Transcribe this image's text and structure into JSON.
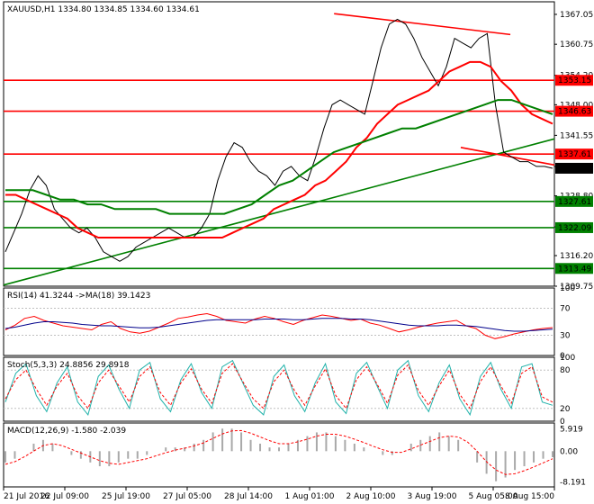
{
  "chart_data": [
    {
      "type": "line",
      "panel": "price",
      "title": "XAUUSD,H1 1334.80 1334.85 1334.60 1334.61",
      "symbol": "XAUUSD,H1",
      "ohlc": [
        1334.8,
        1334.85,
        1334.6,
        1334.61
      ],
      "ylim": [
        1309.75,
        1369.7
      ],
      "yticks": [
        "1367.05",
        "1360.75",
        "1354.20",
        "1348.00",
        "1341.55",
        "1335.00",
        "1328.80",
        "1322.25",
        "1316.20",
        "1309.75"
      ],
      "levels": [
        {
          "value": 1353.15,
          "label": "1353.15",
          "color": "#ff0000"
        },
        {
          "value": 1346.63,
          "label": "1346.63",
          "color": "#ff0000"
        },
        {
          "value": 1337.61,
          "label": "1337.61",
          "color": "#ff0000"
        },
        {
          "value": 1327.61,
          "label": "1327.61",
          "color": "#008000"
        },
        {
          "value": 1322.09,
          "label": "1322.09",
          "color": "#008000"
        },
        {
          "value": 1313.49,
          "label": "1313.49",
          "color": "#008000"
        }
      ],
      "current_price": {
        "value": 1334.61,
        "label": "1334.61"
      },
      "trendlines": [
        {
          "color": "#008000",
          "points": [
            [
              0.0,
              1310.0
            ],
            [
              1.0,
              1340.8
            ]
          ]
        },
        {
          "color": "#ff0000",
          "points": [
            [
              0.6,
              1367.2
            ],
            [
              0.92,
              1362.8
            ]
          ]
        },
        {
          "color": "#ff0000",
          "points": [
            [
              0.83,
              1339.0
            ],
            [
              1.0,
              1335.3
            ]
          ]
        }
      ],
      "series": [
        {
          "name": "Close",
          "color": "#000000",
          "values": [
            1317,
            1321,
            1325,
            1330,
            1333,
            1331,
            1326,
            1324,
            1322,
            1321,
            1322,
            1320,
            1317,
            1316,
            1315,
            1316,
            1318,
            1319,
            1320,
            1321,
            1322,
            1321,
            1320,
            1320,
            1322,
            1325,
            1332,
            1337,
            1340,
            1339,
            1336,
            1334,
            1333,
            1331,
            1334,
            1335,
            1333,
            1332,
            1337,
            1343,
            1348,
            1349,
            1348,
            1347,
            1346,
            1353,
            1360,
            1365,
            1366,
            1365,
            1362,
            1358,
            1355,
            1352,
            1356,
            1362,
            1361,
            1360,
            1362,
            1363,
            1348,
            1338,
            1337,
            1336,
            1336,
            1335,
            1335,
            1334.61
          ]
        },
        {
          "name": "MA fast",
          "color": "#ff0000",
          "values": [
            1329,
            1329,
            1328,
            1327,
            1326,
            1325,
            1324,
            1322,
            1321,
            1320,
            1320,
            1320,
            1320,
            1320,
            1320,
            1320,
            1320,
            1320,
            1320,
            1320,
            1320,
            1320,
            1321,
            1322,
            1323,
            1324,
            1326,
            1327,
            1328,
            1329,
            1331,
            1332,
            1334,
            1336,
            1339,
            1341,
            1344,
            1346,
            1348,
            1349,
            1350,
            1351,
            1353,
            1355,
            1356,
            1357,
            1357,
            1356,
            1353,
            1351,
            1348,
            1346,
            1345,
            1344
          ]
        },
        {
          "name": "MA slow",
          "color": "#008000",
          "values": [
            1330,
            1330,
            1330,
            1329,
            1328,
            1328,
            1327,
            1327,
            1326,
            1326,
            1326,
            1326,
            1325,
            1325,
            1325,
            1325,
            1325,
            1326,
            1327,
            1329,
            1331,
            1332,
            1334,
            1336,
            1338,
            1339,
            1340,
            1341,
            1342,
            1343,
            1343,
            1344,
            1345,
            1346,
            1347,
            1348,
            1349,
            1349,
            1348,
            1347,
            1346
          ]
        }
      ]
    },
    {
      "type": "line",
      "panel": "rsi",
      "title": "RSI(14) 41.3244 ->MA(18) 39.1423",
      "ylim": [
        0,
        100
      ],
      "yticks": [
        "100",
        "70",
        "30",
        "0"
      ],
      "series": [
        {
          "name": "RSI(14)",
          "color": "#ff0000",
          "values": [
            38,
            45,
            55,
            58,
            52,
            48,
            44,
            42,
            40,
            38,
            46,
            50,
            40,
            35,
            33,
            36,
            42,
            48,
            55,
            57,
            60,
            62,
            58,
            52,
            50,
            48,
            54,
            58,
            55,
            50,
            46,
            52,
            56,
            60,
            58,
            55,
            52,
            54,
            48,
            45,
            40,
            35,
            38,
            42,
            45,
            48,
            50,
            52,
            44,
            40,
            30,
            25,
            28,
            32,
            35,
            38,
            40,
            41.3
          ]
        },
        {
          "name": "MA(18)",
          "color": "#00008b",
          "values": [
            40,
            42,
            45,
            48,
            50,
            50,
            49,
            48,
            46,
            45,
            44,
            44,
            43,
            42,
            41,
            41,
            42,
            44,
            46,
            48,
            50,
            52,
            53,
            53,
            53,
            53,
            53,
            54,
            54,
            54,
            53,
            53,
            54,
            55,
            55,
            55,
            54,
            54,
            53,
            51,
            49,
            47,
            45,
            44,
            44,
            44,
            45,
            45,
            44,
            43,
            41,
            39,
            37,
            36,
            36,
            37,
            38,
            39.1
          ]
        }
      ]
    },
    {
      "type": "line",
      "panel": "stoch",
      "title": "Stoch(5,3,3) 24.8856 29.8918",
      "ylim": [
        0,
        100
      ],
      "yticks": [
        "100",
        "80",
        "20",
        "0"
      ],
      "series": [
        {
          "name": "Stoch %K",
          "color": "#20b2aa",
          "values": [
            30,
            75,
            90,
            40,
            15,
            60,
            85,
            30,
            10,
            70,
            88,
            50,
            20,
            80,
            92,
            35,
            15,
            65,
            90,
            45,
            20,
            85,
            95,
            60,
            25,
            10,
            70,
            88,
            40,
            15,
            60,
            90,
            30,
            12,
            75,
            92,
            55,
            20,
            80,
            95,
            40,
            15,
            60,
            88,
            35,
            10,
            70,
            92,
            50,
            20,
            85,
            90,
            30,
            24.9
          ]
        },
        {
          "name": "Stoch %D",
          "color": "#ff0000",
          "values": [
            35,
            65,
            80,
            50,
            25,
            55,
            75,
            40,
            20,
            60,
            80,
            55,
            30,
            70,
            85,
            45,
            25,
            60,
            82,
            50,
            28,
            75,
            90,
            62,
            35,
            20,
            62,
            80,
            48,
            25,
            55,
            82,
            40,
            20,
            65,
            85,
            58,
            28,
            72,
            88,
            48,
            25,
            55,
            80,
            42,
            20,
            62,
            85,
            55,
            28,
            75,
            85,
            38,
            29.9
          ]
        }
      ]
    },
    {
      "type": "bar",
      "panel": "macd",
      "title": "MACD(12,26,9) -1.580 -2.039",
      "ylim": [
        -9.5,
        7.5
      ],
      "yticks": [
        "5.919",
        "0.00",
        "-8.191"
      ],
      "series": [
        {
          "name": "MACD histogram",
          "color": "#a9a9a9",
          "values": [
            -3,
            -2,
            0,
            2,
            3,
            2,
            0,
            -1,
            -2,
            -3,
            -4,
            -4,
            -3,
            -2,
            -2,
            -1,
            0,
            1,
            1,
            1,
            2,
            3,
            5,
            6,
            6,
            5,
            3,
            2,
            1,
            1,
            2,
            3,
            4,
            5,
            5,
            4,
            3,
            2,
            1,
            0,
            -1,
            -1,
            0,
            2,
            3,
            4,
            5,
            4,
            3,
            0,
            -3,
            -6,
            -8,
            -7,
            -5,
            -4,
            -3,
            -2,
            -1.6
          ]
        },
        {
          "name": "Signal",
          "color": "#ff0000",
          "values": [
            -3.5,
            -2.8,
            -1.5,
            0,
            1.5,
            2,
            1.5,
            0.5,
            -0.5,
            -1.5,
            -2.5,
            -3.2,
            -3.5,
            -3,
            -2.5,
            -2,
            -1.2,
            -0.4,
            0.3,
            0.8,
            1.4,
            2.2,
            3.4,
            4.6,
            5.4,
            5.5,
            4.8,
            3.8,
            2.8,
            2,
            2,
            2.5,
            3.2,
            4,
            4.5,
            4.5,
            4,
            3.2,
            2.3,
            1.3,
            0.4,
            -0.3,
            -0.3,
            0.6,
            1.6,
            2.6,
            3.6,
            4,
            3.8,
            2.4,
            0,
            -2.8,
            -5,
            -6.2,
            -6,
            -5.2,
            -4.2,
            -3.1,
            -2.0
          ]
        }
      ]
    }
  ],
  "xaxis": {
    "tick_labels": [
      "21 Jul 2016",
      "22 Jul 09:00",
      "25 Jul 19:00",
      "27 Jul 05:00",
      "28 Jul 14:00",
      "1 Aug 01:00",
      "2 Aug 10:00",
      "3 Aug 19:00",
      "5 Aug 05:00",
      "8 Aug 15:00"
    ]
  }
}
